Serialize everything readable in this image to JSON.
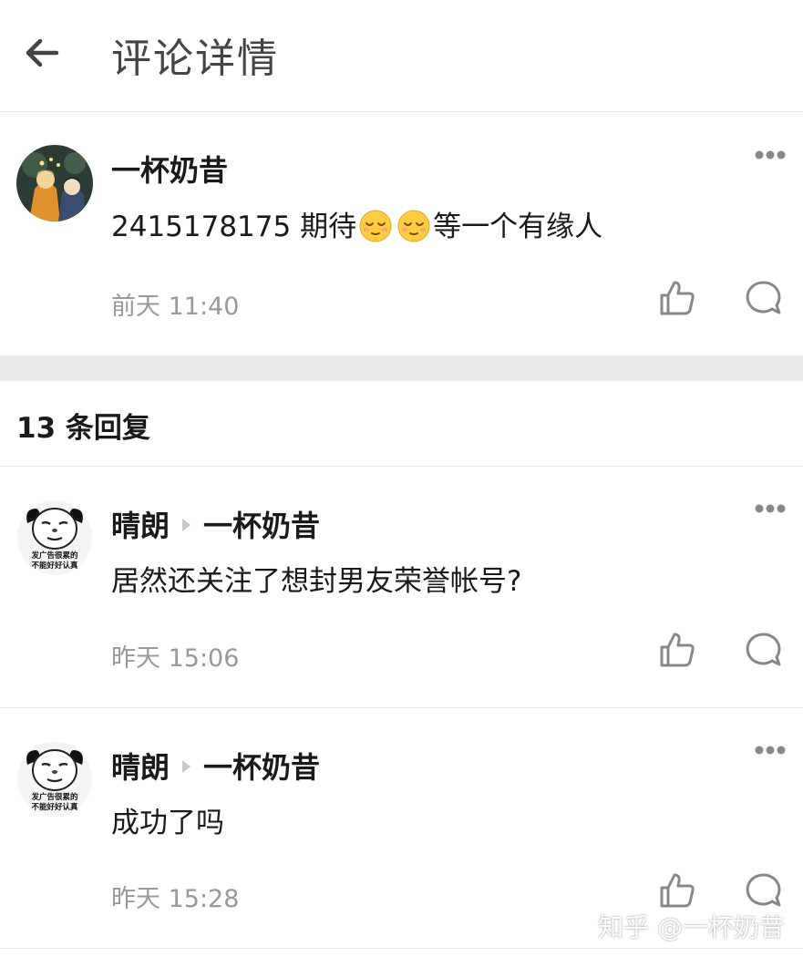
{
  "header": {
    "title": "评论详情"
  },
  "main_comment": {
    "author": "一杯奶昔",
    "text_before": "2415178175 期待",
    "text_after": "等一个有缘人",
    "time": "前天 11:40"
  },
  "replies_count": "13 条回复",
  "replies": [
    {
      "author": "晴朗",
      "reply_to": "一杯奶昔",
      "text": "居然还关注了想封男友荣誉帐号?",
      "time": "昨天 15:06"
    },
    {
      "author": "晴朗",
      "reply_to": "一杯奶昔",
      "text": "成功了吗",
      "time": "昨天 15:28"
    }
  ],
  "avatar_caption": {
    "line1": "发广告很累的",
    "line2": "不能好好认真"
  },
  "watermark": "知乎 @一杯奶昔"
}
